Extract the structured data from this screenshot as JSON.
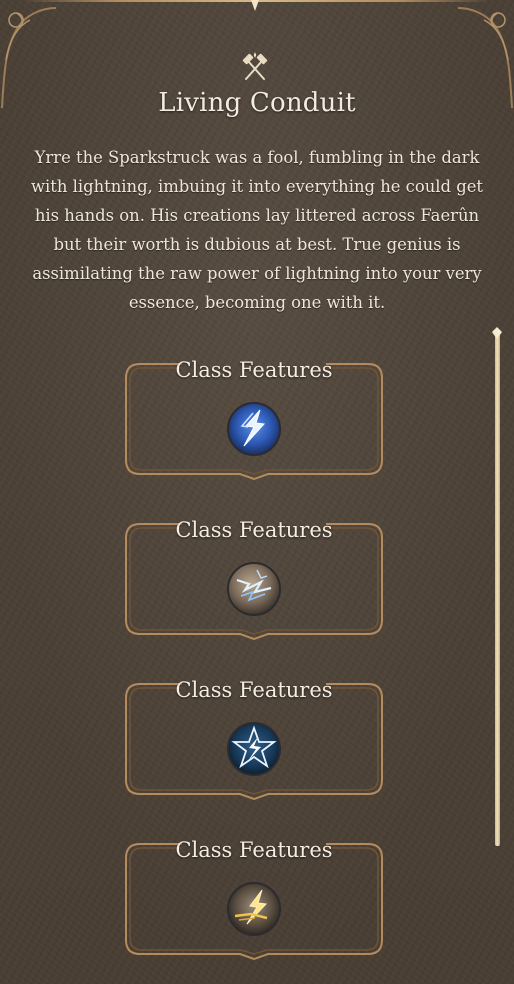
{
  "panel": {
    "title": "Living Conduit",
    "description": "Yrre the Sparkstruck was a fool, fumbling in the dark with lightning, imbuing it into everything he could get his hands on. His creations lay littered across Faerûn but their worth is dubious at best. True genius is assimilating the raw power of lightning into your very essence, becoming one with it.",
    "header_icon": "crossed-hammers-icon"
  },
  "features": [
    {
      "label": "Class Features",
      "icon": "lightning-bolt-icon",
      "accent": "#2f63c4"
    },
    {
      "label": "Class Features",
      "icon": "lightning-storm-icon",
      "accent": "#7d7f86"
    },
    {
      "label": "Class Features",
      "icon": "lightning-star-icon",
      "accent": "#1d3f63"
    },
    {
      "label": "Class Features",
      "icon": "golden-lightning-icon",
      "accent": "#e7c257"
    }
  ],
  "colors": {
    "background": "#4a4036",
    "frame_gold": "#b08d5e",
    "text": "#f1e9dd"
  }
}
